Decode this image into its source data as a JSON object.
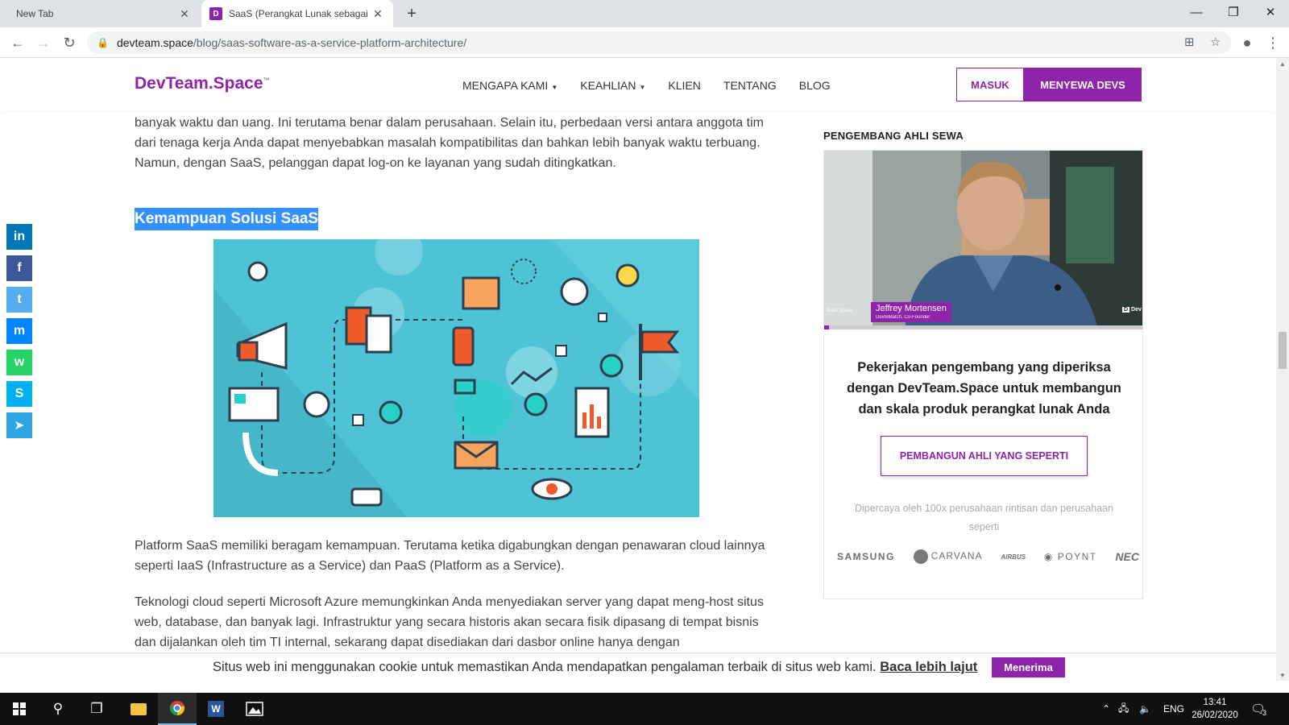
{
  "browser": {
    "tabs": [
      {
        "title": "New Tab",
        "active": false
      },
      {
        "title": "SaaS (Perangkat Lunak sebagai L",
        "active": true,
        "favicon": "D"
      }
    ],
    "url_host": "devteam.space",
    "url_path": "/blog/saas-software-as-a-service-platform-architecture/"
  },
  "site": {
    "logo": "DevTeam.Space",
    "logo_tm": "™",
    "nav": [
      {
        "label": "MENGAPA KAMI",
        "dropdown": true
      },
      {
        "label": "KEAHLIAN",
        "dropdown": true
      },
      {
        "label": "KLIEN",
        "dropdown": false
      },
      {
        "label": "TENTANG",
        "dropdown": false
      },
      {
        "label": "BLOG",
        "dropdown": false
      }
    ],
    "login_label": "MASUK",
    "hire_label": "MENYEWA DEVS",
    "accent": "#8e24aa"
  },
  "share": [
    {
      "name": "linkedin-icon",
      "glyph": "in",
      "color": "#0077b5"
    },
    {
      "name": "facebook-icon",
      "glyph": "f",
      "color": "#3b5998"
    },
    {
      "name": "twitter-icon",
      "glyph": "t",
      "color": "#55acee"
    },
    {
      "name": "messenger-icon",
      "glyph": "m",
      "color": "#0084ff"
    },
    {
      "name": "whatsapp-icon",
      "glyph": "w",
      "color": "#25d366"
    },
    {
      "name": "skype-icon",
      "glyph": "S",
      "color": "#00aff0"
    },
    {
      "name": "telegram-icon",
      "glyph": "➤",
      "color": "#2ca5e0"
    }
  ],
  "article": {
    "p1": "banyak waktu dan uang. Ini terutama benar dalam perusahaan. Selain itu, perbedaan versi antara anggota tim dari tenaga kerja Anda dapat menyebabkan masalah kompatibilitas dan bahkan lebih banyak waktu terbuang. Namun, dengan SaaS, pelanggan dapat log-on ke layanan yang sudah ditingkatkan.",
    "heading": "Kemampuan Solusi SaaS",
    "p2": "Platform SaaS memiliki beragam kemampuan. Terutama ketika digabungkan dengan penawaran cloud lainnya seperti IaaS (Infrastructure as a Service) dan PaaS (Platform as a Service).",
    "p3": "Teknologi cloud seperti Microsoft Azure memungkinkan Anda menyediakan server yang dapat meng-host situs web, database, dan banyak lagi. Infrastruktur yang secara historis akan secara fisik dipasang di tempat bisnis dan dijalankan oleh tim TI internal, sekarang dapat disediakan dari dasbor online hanya dengan"
  },
  "sidebar": {
    "title": "PENGEMBANG AHLI SEWA",
    "video_name": "Jeffrey Mortensen",
    "video_role": "DevteMatch, Co-Founder",
    "video_brand_left": "Team.Space",
    "video_brand_right": "Dev",
    "pitch": "Pekerjakan pengembang yang diperiksa dengan DevTeam.Space untuk membangun dan skala produk perangkat lunak Anda",
    "cta": "PEMBANGUN AHLI YANG SEPERTI",
    "trust": "Dipercaya oleh 100x perusahaan rintisan dan perusahaan seperti",
    "brands": [
      "SAMSUNG",
      "CARVANA",
      "AIRBUS",
      "POYNT",
      "NEC"
    ]
  },
  "cookie": {
    "message": "Situs web ini menggunakan cookie untuk memastikan Anda mendapatkan pengalaman terbaik di situs web kami.",
    "more": "Baca lebih lajut",
    "accept": "Menerima"
  },
  "taskbar": {
    "lang": "ENG",
    "time": "13:41",
    "date": "26/02/2020",
    "notifications": "3"
  }
}
